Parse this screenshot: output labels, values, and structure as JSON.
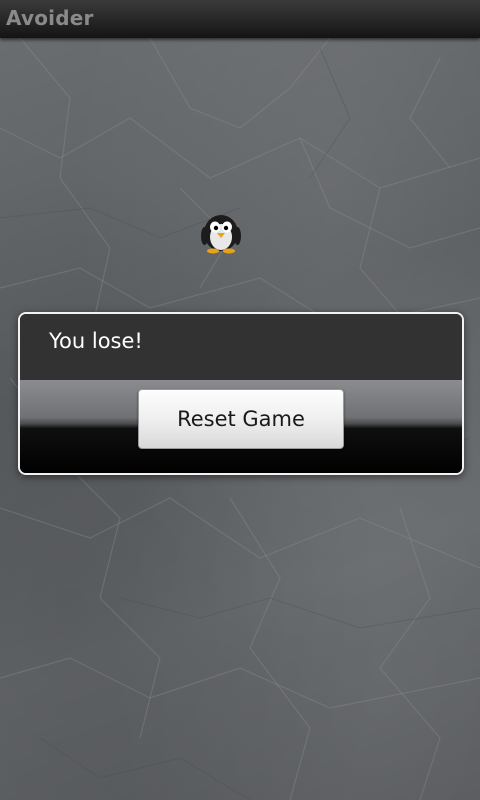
{
  "app": {
    "title": "Avoider"
  },
  "game": {
    "player_icon": "penguin-icon"
  },
  "dialog": {
    "message": "You lose!",
    "button_label": "Reset Game"
  },
  "colors": {
    "title_bar": "#2a2a2a",
    "title_text": "#8a8a8a",
    "dialog_message_bg": "#323232",
    "dialog_border": "#f2f2f2",
    "background": "#5e6164"
  }
}
